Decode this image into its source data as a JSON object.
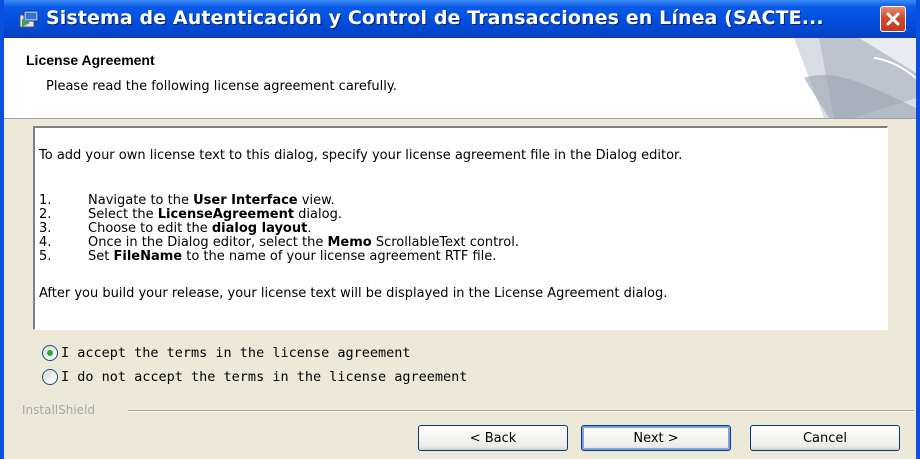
{
  "window": {
    "title": "Sistema de Autenticación y Control de Transacciones en Línea (SACTE..."
  },
  "header": {
    "title": "License Agreement",
    "subtitle": "Please read the following license agreement carefully."
  },
  "license": {
    "intro": "To add your own license text to this dialog, specify your license agreement file in the Dialog editor.",
    "steps": [
      {
        "num": "1.",
        "pre": "Navigate to the ",
        "bold": "User Interface",
        "post": " view."
      },
      {
        "num": "2.",
        "pre": "Select the ",
        "bold": "LicenseAgreement",
        "post": " dialog."
      },
      {
        "num": "3.",
        "pre": "Choose to edit the ",
        "bold": "dialog layout",
        "post": "."
      },
      {
        "num": "4.",
        "pre": "Once in the Dialog editor, select the ",
        "bold": "Memo",
        "post": " ScrollableText control."
      },
      {
        "num": "5.",
        "pre": "Set ",
        "bold": "FileName",
        "post": " to the name of your license agreement RTF file."
      }
    ],
    "outro": "After you build your release, your license text will be displayed in the License Agreement dialog."
  },
  "options": {
    "accept_label": "I accept the terms in the license agreement",
    "decline_label": "I do not accept the terms in the license agreement",
    "selected": "accept"
  },
  "footer": {
    "brand": "InstallShield",
    "back_label": "< Back",
    "next_label": "Next >",
    "cancel_label": "Cancel"
  },
  "colors": {
    "title_bar": "#0350df",
    "close_button": "#d14a2b",
    "radio_selected": "#2fa82f"
  }
}
